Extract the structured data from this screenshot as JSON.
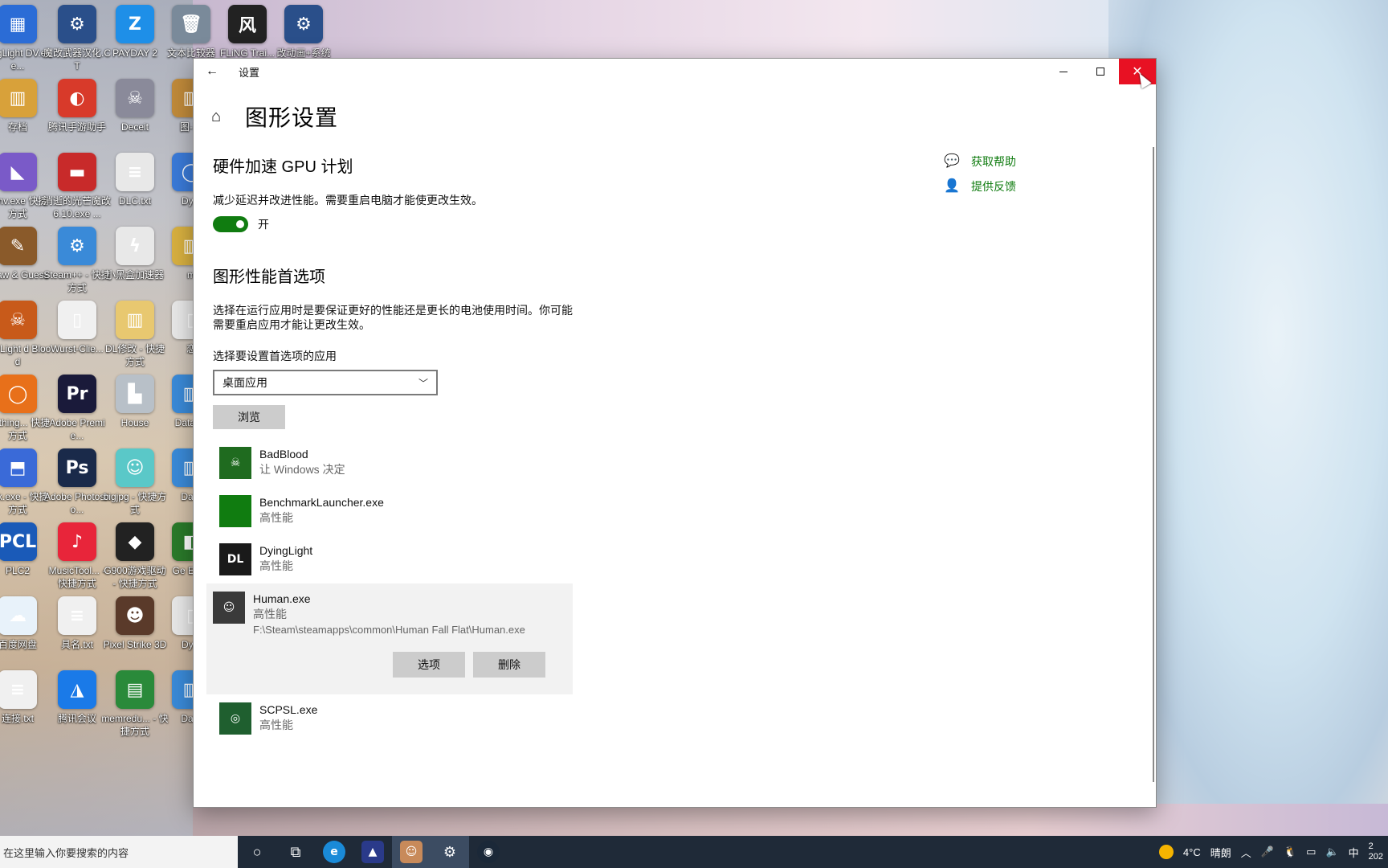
{
  "desktop_icons": [
    {
      "label": "yingLight DV.exe...",
      "color": "#2b6cd6",
      "glyph": "▦"
    },
    {
      "label": "魔改武器汉化.CT",
      "color": "#2a4f8a",
      "glyph": "⚙"
    },
    {
      "label": "PAYDAY 2",
      "color": "#1e8fe8",
      "glyph": "Z"
    },
    {
      "label": "文本比较器",
      "color": "#7a8a9a",
      "glyph": "🗑"
    },
    {
      "label": "FLiNG Trai...",
      "color": "#222222",
      "glyph": "风"
    },
    {
      "label": "改动画+系统",
      "color": "#2a4f8a",
      "glyph": "⚙"
    },
    {
      "label": "存档",
      "color": "#d8a13a",
      "glyph": "▥"
    },
    {
      "label": "腾讯手游助手",
      "color": "#d83a2a",
      "glyph": "◐"
    },
    {
      "label": "Deceit",
      "color": "#8a8a9a",
      "glyph": "☠"
    },
    {
      "label": "图-已",
      "color": "#c08a3a",
      "glyph": "▥"
    },
    {
      "label": "venv.exe 快捷方式",
      "color": "#7a5ac8",
      "glyph": "◣"
    },
    {
      "label": "消逝的光芒魔改6.10.exe ...",
      "color": "#c82a2a",
      "glyph": "▬"
    },
    {
      "label": "DLC.txt",
      "color": "#e8e8e8",
      "glyph": "≡"
    },
    {
      "label": "Dyin",
      "color": "#3a7ad8",
      "glyph": "◯"
    },
    {
      "label": "Draw & Guess",
      "color": "#8a5a2a",
      "glyph": "✎"
    },
    {
      "label": "Steam++ - 快捷方式",
      "color": "#3a8ad8",
      "glyph": "⚙"
    },
    {
      "label": "小黑盒加速器",
      "color": "#e8e8e8",
      "glyph": "ϟ"
    },
    {
      "label": "m",
      "color": "#d8b040",
      "glyph": "▥"
    },
    {
      "label": "ing Light d Blood",
      "color": "#c85a1a",
      "glyph": "☠"
    },
    {
      "label": "Wurst-Clie...",
      "color": "#f0f0f0",
      "glyph": "▯"
    },
    {
      "label": "DL修改 - 快捷方式",
      "color": "#e8c870",
      "glyph": "▥"
    },
    {
      "label": "恋",
      "color": "#e8e8e8",
      "glyph": "▯"
    },
    {
      "label": "erything... 快捷方式",
      "color": "#e8701a",
      "glyph": "◯"
    },
    {
      "label": "Adobe Premie...",
      "color": "#1a1a3a",
      "glyph": "Pr"
    },
    {
      "label": "House",
      "color": "#b8c0c8",
      "glyph": "▙"
    },
    {
      "label": "Data 强",
      "color": "#3a8ad8",
      "glyph": "▥"
    },
    {
      "label": "eek.exe - 快捷方式",
      "color": "#3a6ad8",
      "glyph": "⬒"
    },
    {
      "label": "Adobe Photosho...",
      "color": "#1a2a4a",
      "glyph": "Ps"
    },
    {
      "label": "bigjpg - 快捷方式",
      "color": "#5ac8c8",
      "glyph": "☺"
    },
    {
      "label": "Data",
      "color": "#3a8ad8",
      "glyph": "▥"
    },
    {
      "label": "PLC2",
      "color": "#1a5ab8",
      "glyph": "PCL"
    },
    {
      "label": "MusicTool... - 快捷方式",
      "color": "#e8253a",
      "glyph": "♪"
    },
    {
      "label": "G900游戏驱动 - 快捷方式",
      "color": "#222222",
      "glyph": "◆"
    },
    {
      "label": "Ge Expe",
      "color": "#2a7a2a",
      "glyph": "◧"
    },
    {
      "label": "百度网盘",
      "color": "#e8f2fa",
      "glyph": "☁"
    },
    {
      "label": "具名.txt",
      "color": "#f0f0f0",
      "glyph": "≡"
    },
    {
      "label": "Pixel Strike 3D",
      "color": "#5a3a2a",
      "glyph": "☻"
    },
    {
      "label": "Dyin",
      "color": "#e8e8e8",
      "glyph": "▯"
    },
    {
      "label": "连接.txt",
      "color": "#f0f0f0",
      "glyph": "≡"
    },
    {
      "label": "腾讯会议",
      "color": "#1a7ae8",
      "glyph": "◮"
    },
    {
      "label": "memredu... - 快捷方式",
      "color": "#2a8a3a",
      "glyph": "▤"
    },
    {
      "label": "Data",
      "color": "#3a8ad8",
      "glyph": "▥"
    }
  ],
  "window": {
    "title": "设置",
    "back_glyph": "←",
    "close_glyph": "✕",
    "page_title": "图形设置",
    "home_glyph": "⌂"
  },
  "gpu_section": {
    "heading": "硬件加速 GPU 计划",
    "description": "减少延迟并改进性能。需要重启电脑才能使更改生效。",
    "toggle_state": "开",
    "toggle_on": true
  },
  "perf_section": {
    "heading": "图形性能首选项",
    "description_line1": "选择在运行应用时是要保证更好的性能还是更长的电池使用时间。你可能",
    "description_line2": "需要重启应用才能让更改生效。",
    "select_label": "选择要设置首选项的应用",
    "select_value": "桌面应用",
    "browse_label": "浏览"
  },
  "apps": [
    {
      "name": "BadBlood",
      "pref": "让 Windows 决定",
      "icon": "☠",
      "icon_color": "#1f6b1f"
    },
    {
      "name": "BenchmarkLauncher.exe",
      "pref": "高性能",
      "icon": "",
      "icon_color": "#107c10"
    },
    {
      "name": "DyingLight",
      "pref": "高性能",
      "icon": "DL",
      "icon_color": "#1a1a1a"
    },
    {
      "name": "Human.exe",
      "pref": "高性能",
      "path": "F:\\Steam\\steamapps\\common\\Human Fall Flat\\Human.exe",
      "icon": "☺",
      "icon_color": "#3a3a3a",
      "options_label": "选项",
      "delete_label": "删除"
    },
    {
      "name": "SCPSL.exe",
      "pref": "高性能",
      "icon": "◎",
      "icon_color": "#1f5f2f"
    }
  ],
  "aside": {
    "help_label": "获取帮助",
    "feedback_label": "提供反馈"
  },
  "taskbar": {
    "search_placeholder": "在这里输入你要搜索的内容",
    "weather_temp": "4°C",
    "weather_desc": "晴朗",
    "ime": "中",
    "clock_partial": "2\n202"
  }
}
